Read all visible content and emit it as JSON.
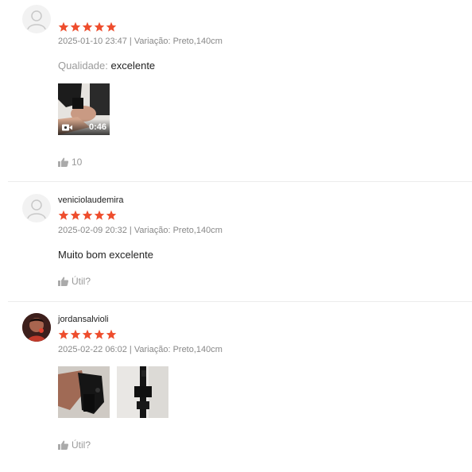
{
  "reviews": [
    {
      "username": "",
      "rating": 5,
      "timestamp": "2025-01-10 23:47",
      "variation_label": "Variação:",
      "variation_value": "Preto,140cm",
      "quality_label": "Qualidade:",
      "quality_value": "excelente",
      "video_duration": "0:46",
      "likes": "10"
    },
    {
      "username": "veniciolaudemira",
      "rating": 5,
      "timestamp": "2025-02-09 20:32",
      "variation_label": "Variação:",
      "variation_value": "Preto,140cm",
      "text": "Muito bom excelente",
      "helpful_label": "Útil?"
    },
    {
      "username": "jordansalvioli",
      "rating": 5,
      "timestamp": "2025-02-22 06:02",
      "variation_label": "Variação:",
      "variation_value": "Preto,140cm",
      "helpful_label": "Útil?"
    }
  ],
  "colors": {
    "star": "#ee4d2d",
    "divider": "#ececec",
    "muted": "#888888"
  },
  "icons": {
    "like": "thumbs-up-icon",
    "video": "video-camera-icon",
    "avatar_default": "user-silhouette-icon"
  }
}
